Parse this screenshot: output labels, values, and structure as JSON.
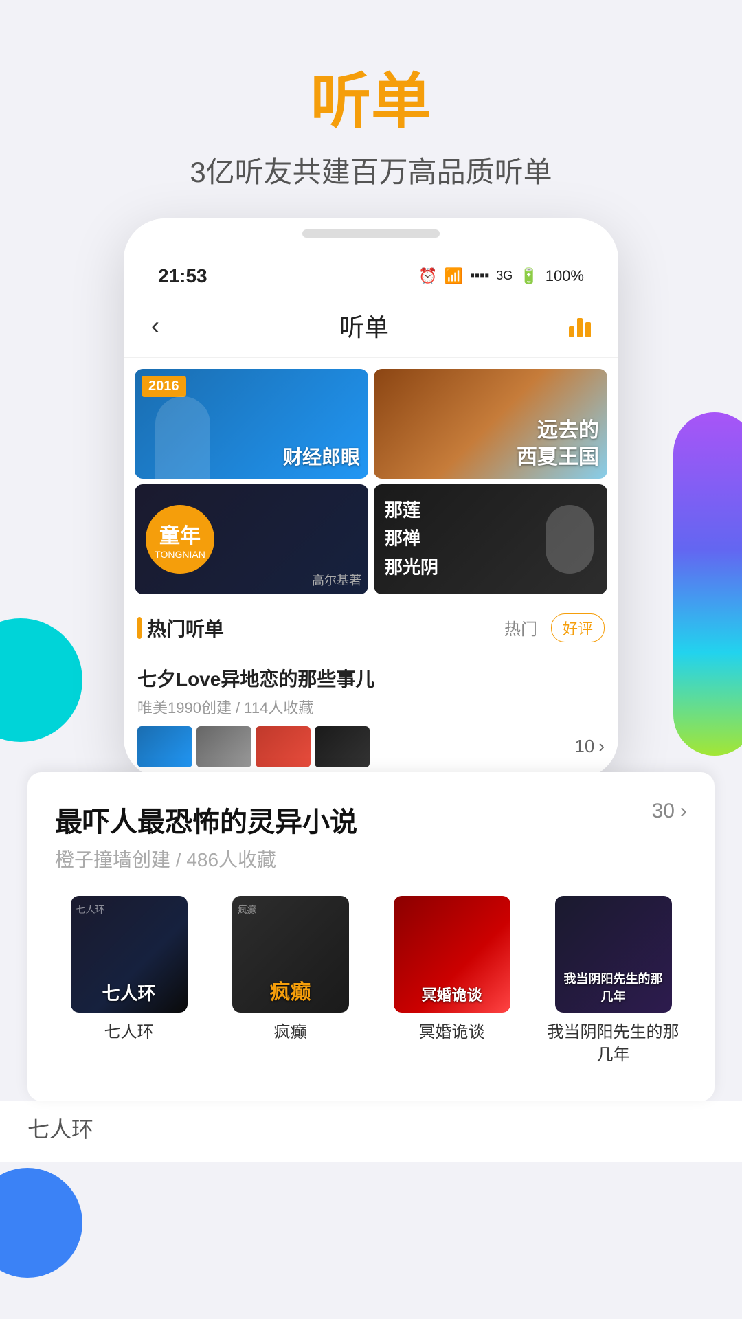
{
  "page": {
    "title": "听单",
    "subtitle": "3亿听友共建百万高品质听单"
  },
  "statusBar": {
    "time": "21:53",
    "battery": "100%"
  },
  "navbar": {
    "back_label": "‹",
    "title": "听单"
  },
  "banners": [
    {
      "id": "banner-1",
      "type": "blue",
      "year_badge": "2016",
      "title": "财经郎眼",
      "alt": "财经郎眼"
    },
    {
      "id": "banner-2",
      "type": "desert",
      "title": "远去的\n西夏王国",
      "alt": "远去的西夏王国"
    },
    {
      "id": "banner-3",
      "type": "dark",
      "circle_text": "童年",
      "circle_sub": "TONGNIAN",
      "author": "高尔基著",
      "alt": "童年"
    },
    {
      "id": "banner-4",
      "type": "black",
      "title": "那莲\n那禅\n那光阴",
      "alt": "那莲那禅那光阴"
    }
  ],
  "section": {
    "title": "热门听单",
    "tab_hot": "热门",
    "tab_rating": "好评"
  },
  "playlist_1": {
    "title": "七夕Love异地恋的那些事儿",
    "meta": "唯美1990创建 / 114人收藏",
    "count": "10"
  },
  "playlist_2": {
    "title": "最吓人最恐怖的灵异小说",
    "meta": "橙子撞墙创建 / 486人收藏",
    "count": "30"
  },
  "books": [
    {
      "id": "book-1",
      "cover_class": "book-cover-1",
      "cover_text": "七人环",
      "title": "七人环"
    },
    {
      "id": "book-2",
      "cover_class": "book-cover-2",
      "cover_text": "疯癫",
      "title": "疯癫"
    },
    {
      "id": "book-3",
      "cover_class": "book-cover-3",
      "cover_text": "冥婚诡谈",
      "title": "冥婚诡谈"
    },
    {
      "id": "book-4",
      "cover_class": "book-cover-4",
      "cover_text": "我当阴阳先生的那几年",
      "title": "我当阴阳先生的那几年"
    }
  ],
  "second_playlist": {
    "title": "七人环",
    "meta": ""
  }
}
